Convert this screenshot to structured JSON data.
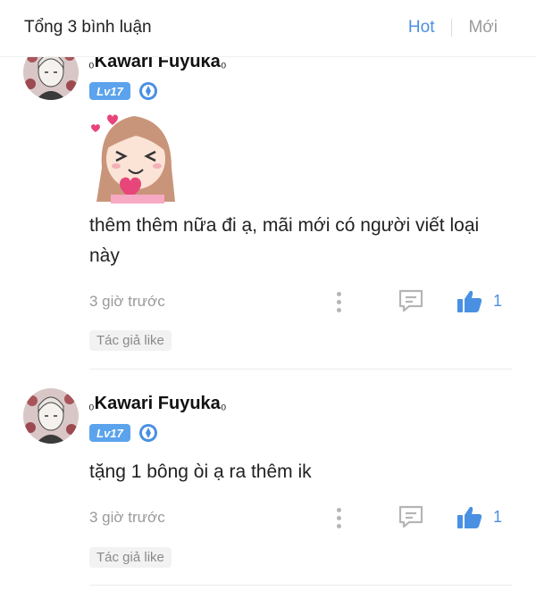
{
  "header": {
    "title": "Tổng 3 bình luận",
    "sort_hot": "Hot",
    "sort_new": "Mới"
  },
  "colors": {
    "accent": "#4a90e2",
    "level_badge": "#5ba3ec",
    "muted": "#9a9a9a"
  },
  "comments": [
    {
      "username": "Kawari Fuyuka",
      "level": "Lv17",
      "sticker": "girl-heart-sticker",
      "text": "thêm thêm nữa đi ạ, mãi mới có người viết loại này",
      "time": "3 giờ trước",
      "likes": "1",
      "author_like": "Tác giả like"
    },
    {
      "username": "Kawari Fuyuka",
      "level": "Lv17",
      "text": "tặng 1 bông òi ạ ra thêm ik",
      "time": "3 giờ trước",
      "likes": "1",
      "author_like": "Tác giả like"
    }
  ]
}
